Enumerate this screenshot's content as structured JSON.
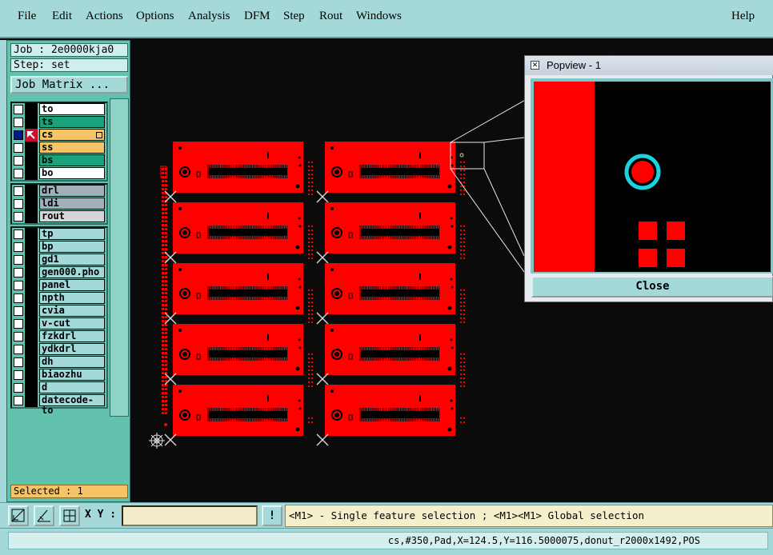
{
  "menu": {
    "items": [
      {
        "label": "File",
        "u": "F",
        "rest": "ile"
      },
      {
        "label": "Edit",
        "u": "E",
        "rest": "dit"
      },
      {
        "label": "Actions",
        "u": "A",
        "rest": "ctions"
      },
      {
        "label": "Options",
        "u": "",
        "rest": "Options"
      },
      {
        "label": "Analysis",
        "u": "",
        "rest": "Analysis"
      },
      {
        "label": "DFM",
        "u": "",
        "rest": "DFM"
      },
      {
        "label": "Step",
        "u": "S",
        "rest": "tep"
      },
      {
        "label": "Rout",
        "u": "R",
        "rest": "out"
      },
      {
        "label": "Windows",
        "u": "W",
        "rest": "indows"
      }
    ],
    "help": "Help"
  },
  "left": {
    "job": "Job : 2e0000kja0",
    "step": "Step: set",
    "job_matrix": "Job Matrix ...",
    "groups": [
      [
        {
          "name": "to",
          "color": "#ffffff",
          "checked": false
        },
        {
          "name": "ts",
          "color": "#1aa37a",
          "checked": false
        },
        {
          "name": "cs",
          "color": "#f5c466",
          "checked": true,
          "active": true
        },
        {
          "name": "ss",
          "color": "#f5c466",
          "checked": false
        },
        {
          "name": "bs",
          "color": "#1aa37a",
          "checked": false
        },
        {
          "name": "bo",
          "color": "#ffffff",
          "checked": false
        }
      ],
      [
        {
          "name": "drl",
          "color": "#9fb0b8",
          "checked": false
        },
        {
          "name": "ldi",
          "color": "#9fb0b8",
          "checked": false
        },
        {
          "name": "rout",
          "color": "#d6d6d6",
          "checked": false
        }
      ],
      [
        {
          "name": "tp",
          "color": "#a4d8d9",
          "checked": false
        },
        {
          "name": "bp",
          "color": "#a4d8d9",
          "checked": false
        },
        {
          "name": "gd1",
          "color": "#a4d8d9",
          "checked": false
        },
        {
          "name": "gen000.pho",
          "color": "#a4d8d9",
          "checked": false
        },
        {
          "name": "panel",
          "color": "#a4d8d9",
          "checked": false
        },
        {
          "name": "npth",
          "color": "#a4d8d9",
          "checked": false
        },
        {
          "name": "cvia",
          "color": "#a4d8d9",
          "checked": false
        },
        {
          "name": "v-cut",
          "color": "#a4d8d9",
          "checked": false
        },
        {
          "name": "fzkdrl",
          "color": "#a4d8d9",
          "checked": false
        },
        {
          "name": "ydkdrl",
          "color": "#a4d8d9",
          "checked": false
        },
        {
          "name": "dh",
          "color": "#a4d8d9",
          "checked": false
        },
        {
          "name": "biaozhu",
          "color": "#a4d8d9",
          "checked": false
        },
        {
          "name": "d",
          "color": "#a4d8d9",
          "checked": false
        },
        {
          "name": "datecode-to",
          "color": "#a4d8d9",
          "checked": false
        }
      ]
    ],
    "selected": "Selected : 1"
  },
  "popview": {
    "title": "Popview - 1",
    "close": "Close"
  },
  "bottom": {
    "xy_label": "X Y :",
    "xy_value": "",
    "excl": "!",
    "message": "<M1> - Single feature selection ; <M1><M1> Global selection"
  },
  "status": "cs,#350,Pad,X=124.5,Y=116.5000075,donut_r2000x1492,POS",
  "colors": {
    "board": "#ff0000",
    "background": "#0b0b0b",
    "panel": "#63c2ad",
    "ring": "#19d3e0"
  }
}
